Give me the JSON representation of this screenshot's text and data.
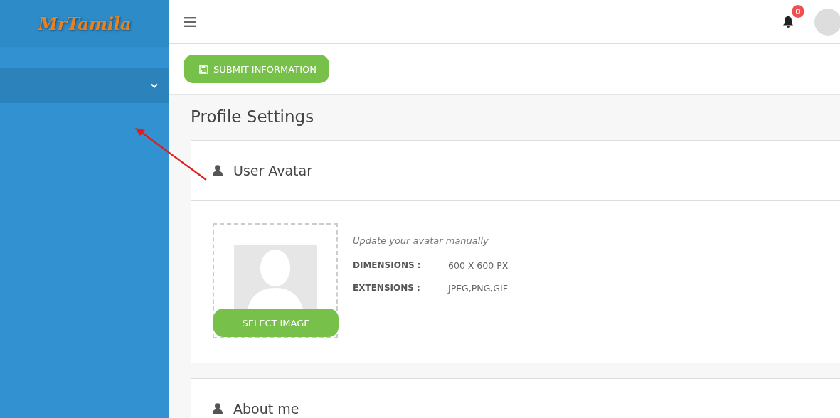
{
  "sidebar": {
    "logo": "MrTamila",
    "items": [
      {
        "kind": "dropdown",
        "expanded": false
      }
    ]
  },
  "topbar": {
    "notifications": {
      "count": "0"
    }
  },
  "toolbar": {
    "button": "SUBMIT INFORMATION"
  },
  "page_title": "Profile Settings",
  "avatar_card": {
    "title": "User Avatar",
    "hint": "Update your avatar manually",
    "button": "SELECT IMAGE",
    "details": [
      {
        "label": "DIMENSIONS :",
        "value": "600 X 600 PX"
      },
      {
        "label": "EXTENSIONS :",
        "value": "JPEG,PNG,GIF"
      }
    ]
  },
  "about_card": {
    "title": "About me"
  }
}
